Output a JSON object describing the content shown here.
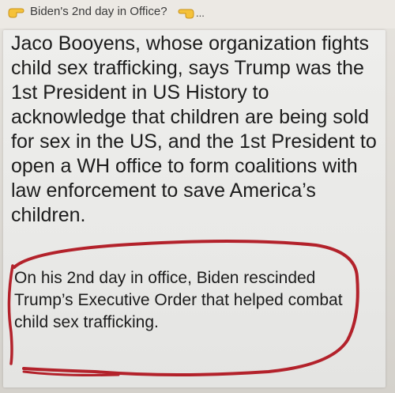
{
  "header": {
    "title": "Biden's 2nd day in Office?",
    "ellipsis": "...",
    "left_icon": "pointing-hand-right-icon",
    "right_icon": "pointing-hand-left-icon"
  },
  "post": {
    "paragraph_1": "Jaco Booyens, whose organization fights child sex trafficking, says Trump was the 1st President in US History to acknowledge that children are being sold for sex in the US, and the 1st President to open a WH office to form coalitions with law enforcement to save America’s children.",
    "paragraph_2": "On his 2nd day in office, Biden rescinded Trump’s Executive Order that helped combat child sex trafficking."
  },
  "colors": {
    "circle_stroke": "#b3222b",
    "text": "#1c1c1c",
    "emoji_yellow": "#f5c23a"
  }
}
